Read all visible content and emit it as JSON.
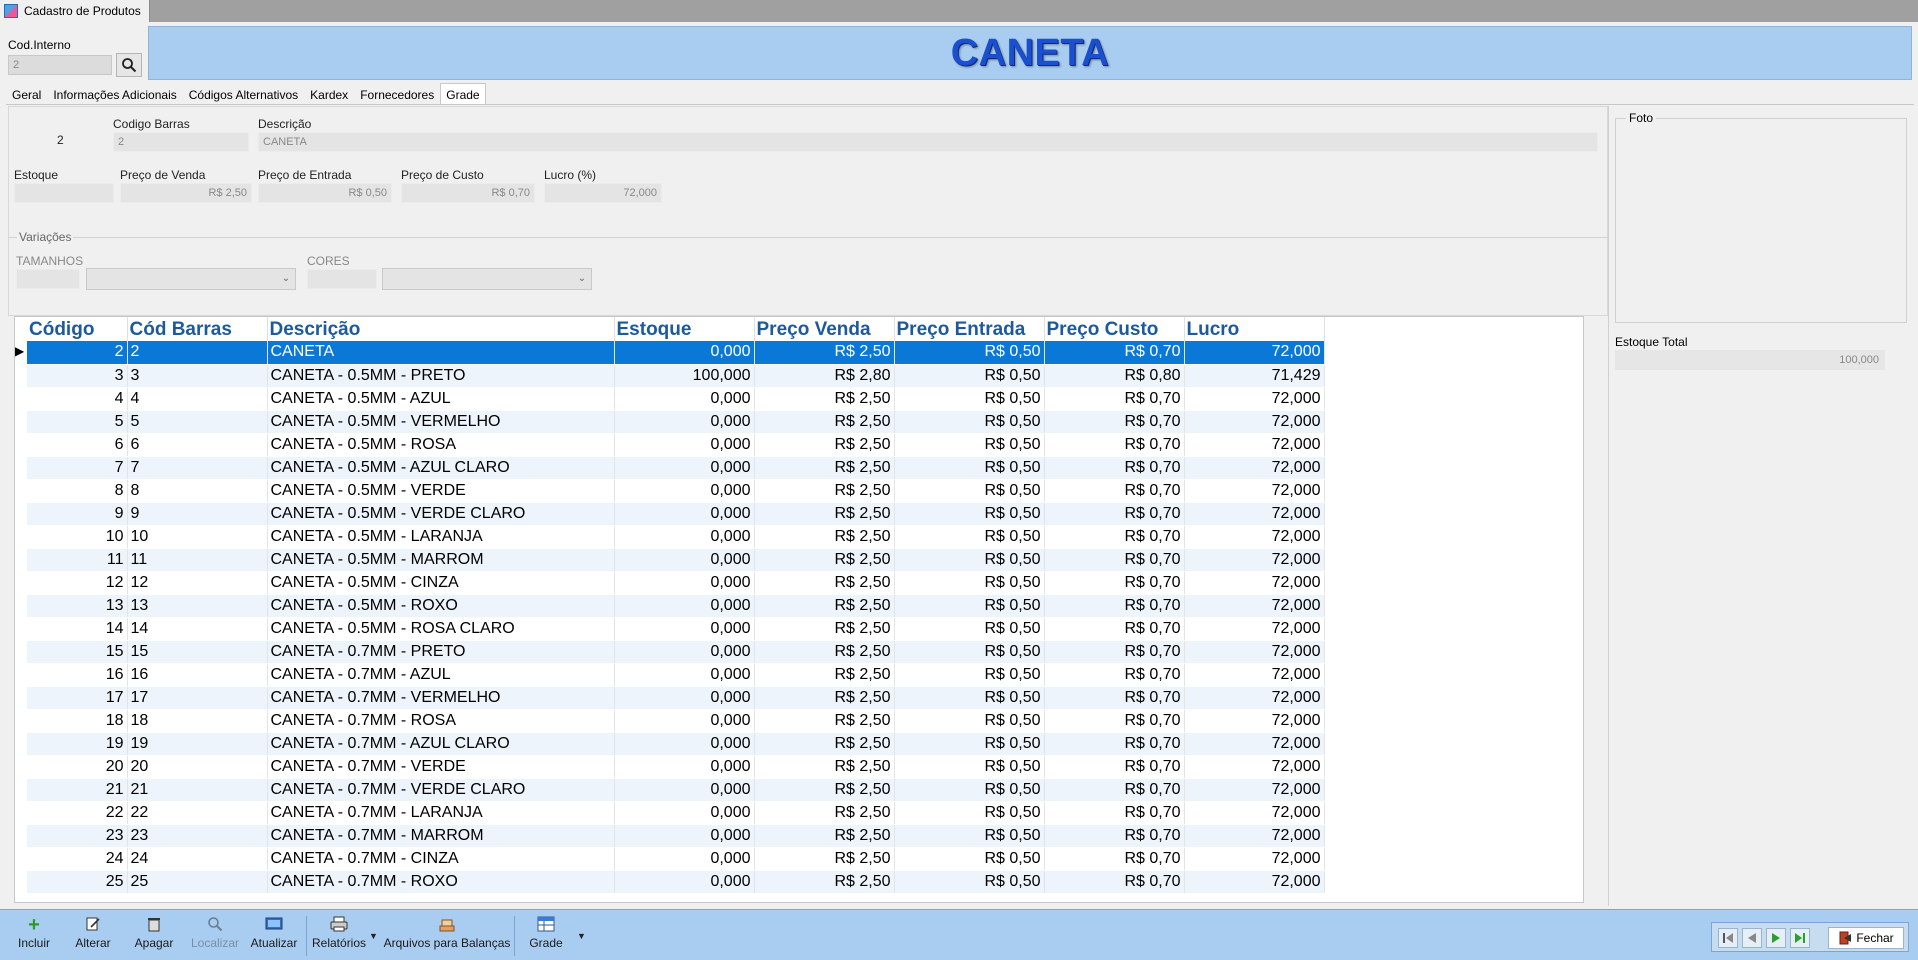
{
  "window": {
    "tab_title": "Cadastro de Produtos"
  },
  "header": {
    "cod_label": "Cod.Interno",
    "cod_value": "2",
    "product_title": "CANETA",
    "title_color": "#1a4fd0",
    "panel_color": "#a9cdf0"
  },
  "tabs": [
    {
      "label": "Geral"
    },
    {
      "label": "Informações Adicionais"
    },
    {
      "label": "Códigos Alternativos"
    },
    {
      "label": "Kardex"
    },
    {
      "label": "Fornecedores"
    },
    {
      "label": "Grade"
    }
  ],
  "active_tab": "Grade",
  "form": {
    "codigo_value": "2",
    "codigo_barras_label": "Codigo Barras",
    "codigo_barras_value": "2",
    "descricao_label": "Descrição",
    "descricao_value": "CANETA",
    "estoque_label": "Estoque",
    "estoque_value": "",
    "preco_venda_label": "Preço de Venda",
    "preco_venda_value": "R$ 2,50",
    "preco_entrada_label": "Preço de Entrada",
    "preco_entrada_value": "R$ 0,50",
    "preco_custo_label": "Preço de Custo",
    "preco_custo_value": "R$ 0,70",
    "lucro_label": "Lucro (%)",
    "lucro_value": "72,000",
    "variacoes_label": "Variações",
    "tamanhos_label": "TAMANHOS",
    "cores_label": "CORES"
  },
  "right_panel": {
    "foto_label": "Foto",
    "estoque_total_label": "Estoque Total",
    "estoque_total_value": "100,000"
  },
  "grid": {
    "columns": [
      "Código",
      "Cód Barras",
      "Descrição",
      "Estoque",
      "Preço Venda",
      "Preço Entrada",
      "Preço Custo",
      "Lucro"
    ],
    "selected_index": 0,
    "rows": [
      [
        "2",
        "2",
        "CANETA",
        "0,000",
        "R$ 2,50",
        "R$ 0,50",
        "R$ 0,70",
        "72,000"
      ],
      [
        "3",
        "3",
        "CANETA - 0.5MM - PRETO",
        "100,000",
        "R$ 2,80",
        "R$ 0,50",
        "R$ 0,80",
        "71,429"
      ],
      [
        "4",
        "4",
        "CANETA - 0.5MM - AZUL",
        "0,000",
        "R$ 2,50",
        "R$ 0,50",
        "R$ 0,70",
        "72,000"
      ],
      [
        "5",
        "5",
        "CANETA - 0.5MM - VERMELHO",
        "0,000",
        "R$ 2,50",
        "R$ 0,50",
        "R$ 0,70",
        "72,000"
      ],
      [
        "6",
        "6",
        "CANETA - 0.5MM - ROSA",
        "0,000",
        "R$ 2,50",
        "R$ 0,50",
        "R$ 0,70",
        "72,000"
      ],
      [
        "7",
        "7",
        "CANETA - 0.5MM - AZUL CLARO",
        "0,000",
        "R$ 2,50",
        "R$ 0,50",
        "R$ 0,70",
        "72,000"
      ],
      [
        "8",
        "8",
        "CANETA - 0.5MM - VERDE",
        "0,000",
        "R$ 2,50",
        "R$ 0,50",
        "R$ 0,70",
        "72,000"
      ],
      [
        "9",
        "9",
        "CANETA - 0.5MM - VERDE CLARO",
        "0,000",
        "R$ 2,50",
        "R$ 0,50",
        "R$ 0,70",
        "72,000"
      ],
      [
        "10",
        "10",
        "CANETA - 0.5MM - LARANJA",
        "0,000",
        "R$ 2,50",
        "R$ 0,50",
        "R$ 0,70",
        "72,000"
      ],
      [
        "11",
        "11",
        "CANETA - 0.5MM - MARROM",
        "0,000",
        "R$ 2,50",
        "R$ 0,50",
        "R$ 0,70",
        "72,000"
      ],
      [
        "12",
        "12",
        "CANETA - 0.5MM - CINZA",
        "0,000",
        "R$ 2,50",
        "R$ 0,50",
        "R$ 0,70",
        "72,000"
      ],
      [
        "13",
        "13",
        "CANETA - 0.5MM - ROXO",
        "0,000",
        "R$ 2,50",
        "R$ 0,50",
        "R$ 0,70",
        "72,000"
      ],
      [
        "14",
        "14",
        "CANETA - 0.5MM - ROSA CLARO",
        "0,000",
        "R$ 2,50",
        "R$ 0,50",
        "R$ 0,70",
        "72,000"
      ],
      [
        "15",
        "15",
        "CANETA - 0.7MM - PRETO",
        "0,000",
        "R$ 2,50",
        "R$ 0,50",
        "R$ 0,70",
        "72,000"
      ],
      [
        "16",
        "16",
        "CANETA - 0.7MM - AZUL",
        "0,000",
        "R$ 2,50",
        "R$ 0,50",
        "R$ 0,70",
        "72,000"
      ],
      [
        "17",
        "17",
        "CANETA - 0.7MM - VERMELHO",
        "0,000",
        "R$ 2,50",
        "R$ 0,50",
        "R$ 0,70",
        "72,000"
      ],
      [
        "18",
        "18",
        "CANETA - 0.7MM - ROSA",
        "0,000",
        "R$ 2,50",
        "R$ 0,50",
        "R$ 0,70",
        "72,000"
      ],
      [
        "19",
        "19",
        "CANETA - 0.7MM - AZUL CLARO",
        "0,000",
        "R$ 2,50",
        "R$ 0,50",
        "R$ 0,70",
        "72,000"
      ],
      [
        "20",
        "20",
        "CANETA - 0.7MM - VERDE",
        "0,000",
        "R$ 2,50",
        "R$ 0,50",
        "R$ 0,70",
        "72,000"
      ],
      [
        "21",
        "21",
        "CANETA - 0.7MM - VERDE CLARO",
        "0,000",
        "R$ 2,50",
        "R$ 0,50",
        "R$ 0,70",
        "72,000"
      ],
      [
        "22",
        "22",
        "CANETA - 0.7MM - LARANJA",
        "0,000",
        "R$ 2,50",
        "R$ 0,50",
        "R$ 0,70",
        "72,000"
      ],
      [
        "23",
        "23",
        "CANETA - 0.7MM - MARROM",
        "0,000",
        "R$ 2,50",
        "R$ 0,50",
        "R$ 0,70",
        "72,000"
      ],
      [
        "24",
        "24",
        "CANETA - 0.7MM - CINZA",
        "0,000",
        "R$ 2,50",
        "R$ 0,50",
        "R$ 0,70",
        "72,000"
      ],
      [
        "25",
        "25",
        "CANETA - 0.7MM - ROXO",
        "0,000",
        "R$ 2,50",
        "R$ 0,50",
        "R$ 0,70",
        "72,000"
      ]
    ]
  },
  "toolbar": {
    "incluir": "Incluir",
    "alterar": "Alterar",
    "apagar": "Apagar",
    "localizar": "Localizar",
    "atualizar": "Atualizar",
    "relatorios": "Relatórios",
    "arquivos_balancas": "Arquivos para Balanças",
    "grade": "Grade",
    "fechar": "Fechar"
  },
  "icons": {
    "app": "app-icon",
    "search": "search-icon",
    "incluir": "plus-icon",
    "alterar": "edit-icon",
    "apagar": "trash-icon",
    "localizar": "magnifier-icon",
    "atualizar": "refresh-icon",
    "relatorios": "printer-icon",
    "arquivos": "scale-icon",
    "grade": "grid-icon",
    "fechar": "door-exit-icon"
  },
  "colors": {
    "selected_row": "#0a78d7",
    "header_text": "#1e5a9a",
    "toolbar_bg": "#a9cdf0",
    "alt_row": "#eef4fb"
  }
}
